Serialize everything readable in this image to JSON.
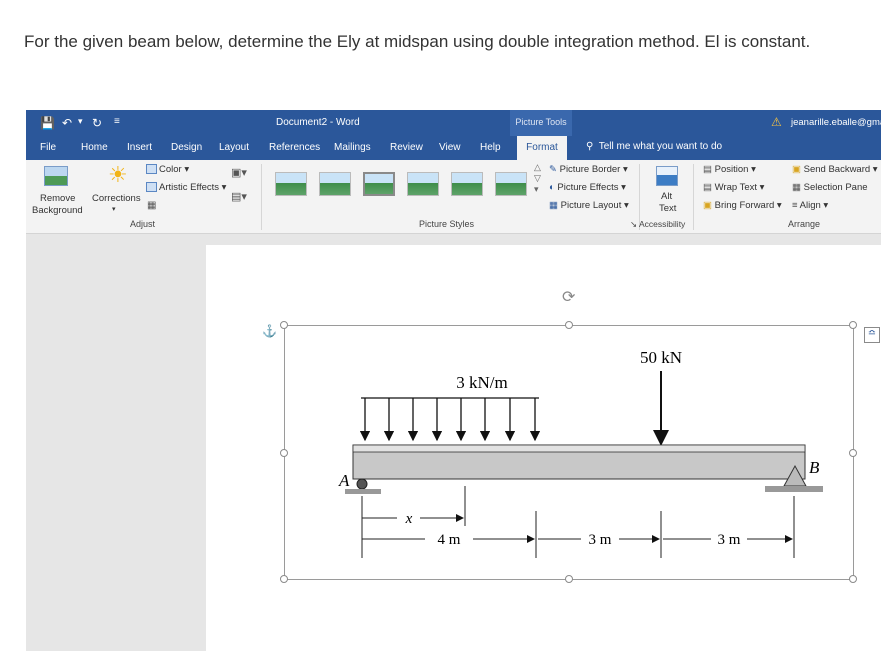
{
  "question": "For the given beam below, determine the Ely at midspan using double integration method. El is constant.",
  "titlebar": {
    "doc_title": "Document2 - Word",
    "context_tab": "Picture Tools",
    "user": "jeanarille.eballe@gmai"
  },
  "tabs": [
    "File",
    "Home",
    "Insert",
    "Design",
    "Layout",
    "References",
    "Mailings",
    "Review",
    "View",
    "Help"
  ],
  "active_tab": "Format",
  "tell_me": "Tell me what you want to do",
  "ribbon": {
    "remove_bg_1": "Remove",
    "remove_bg_2": "Background",
    "corrections": "Corrections",
    "color": "Color",
    "artistic": "Artistic Effects",
    "adjust": "Adjust",
    "picture_styles": "Picture Styles",
    "border": "Picture Border",
    "effects": "Picture Effects",
    "layout": "Picture Layout",
    "alt_1": "Alt",
    "alt_2": "Text",
    "accessibility": "Accessibility",
    "position": "Position",
    "wrap": "Wrap Text",
    "forward": "Bring Forward",
    "backward": "Send Backward",
    "selection": "Selection Pane",
    "align": "Align",
    "arrange": "Arrange"
  },
  "figure": {
    "load_dist": "3 kN/m",
    "load_point": "50 kN",
    "support_a": "A",
    "support_b": "B",
    "dim_x": "x",
    "dim_1": "4 m",
    "dim_2": "3 m",
    "dim_3": "3 m"
  },
  "colors": {
    "titlebar": "#2b579a",
    "ribbon": "#f3f3f3",
    "canvas": "#e6e6e6"
  }
}
